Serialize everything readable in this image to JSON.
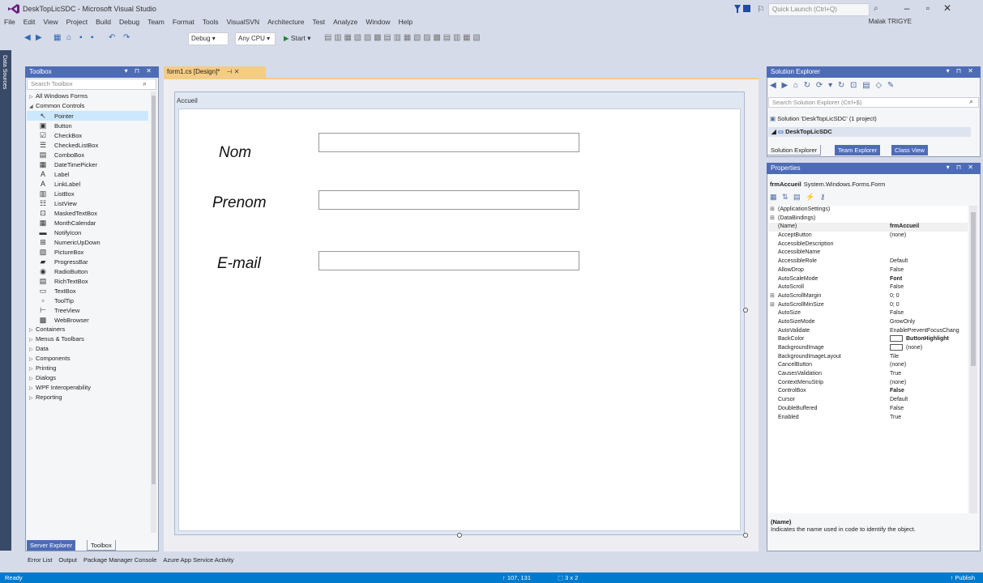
{
  "window": {
    "title": "DeskTopLicSDC - Microsoft Visual Studio",
    "quick_launch_placeholder": "Quick Launch (Ctrl+Q)",
    "user": "Malak TRIGYE"
  },
  "menu": [
    "File",
    "Edit",
    "View",
    "Project",
    "Build",
    "Debug",
    "Team",
    "Format",
    "Tools",
    "VisualSVN",
    "Architecture",
    "Test",
    "Analyze",
    "Window",
    "Help"
  ],
  "toolbar": {
    "config": "Debug",
    "platform": "Any CPU",
    "start": "Start"
  },
  "side_strip_label": "Data Sources",
  "toolbox": {
    "title": "Toolbox",
    "search_placeholder": "Search Toolbox",
    "items": [
      {
        "type": "cat",
        "arrow": "▷",
        "label": "All Windows Forms"
      },
      {
        "type": "cat",
        "arrow": "◢",
        "label": "Common Controls"
      },
      {
        "type": "item",
        "glyph": "↖",
        "label": "Pointer",
        "selected": true
      },
      {
        "type": "item",
        "glyph": "▣",
        "label": "Button"
      },
      {
        "type": "item",
        "glyph": "☑",
        "label": "CheckBox"
      },
      {
        "type": "item",
        "glyph": "☰",
        "label": "CheckedListBox"
      },
      {
        "type": "item",
        "glyph": "▤",
        "label": "ComboBox"
      },
      {
        "type": "item",
        "glyph": "▦",
        "label": "DateTimePicker"
      },
      {
        "type": "item",
        "glyph": "A",
        "label": "Label"
      },
      {
        "type": "item",
        "glyph": "A",
        "label": "LinkLabel"
      },
      {
        "type": "item",
        "glyph": "▥",
        "label": "ListBox"
      },
      {
        "type": "item",
        "glyph": "☷",
        "label": "ListView"
      },
      {
        "type": "item",
        "glyph": "⊡",
        "label": "MaskedTextBox"
      },
      {
        "type": "item",
        "glyph": "▦",
        "label": "MonthCalendar"
      },
      {
        "type": "item",
        "glyph": "▬",
        "label": "NotifyIcon"
      },
      {
        "type": "item",
        "glyph": "⊞",
        "label": "NumericUpDown"
      },
      {
        "type": "item",
        "glyph": "▨",
        "label": "PictureBox"
      },
      {
        "type": "item",
        "glyph": "▰",
        "label": "ProgressBar"
      },
      {
        "type": "item",
        "glyph": "◉",
        "label": "RadioButton"
      },
      {
        "type": "item",
        "glyph": "▤",
        "label": "RichTextBox"
      },
      {
        "type": "item",
        "glyph": "▭",
        "label": "TextBox"
      },
      {
        "type": "item",
        "glyph": "▫",
        "label": "ToolTip"
      },
      {
        "type": "item",
        "glyph": "⊢",
        "label": "TreeView"
      },
      {
        "type": "item",
        "glyph": "▩",
        "label": "WebBrowser"
      },
      {
        "type": "cat",
        "arrow": "▷",
        "label": "Containers"
      },
      {
        "type": "cat",
        "arrow": "▷",
        "label": "Menus & Toolbars"
      },
      {
        "type": "cat",
        "arrow": "▷",
        "label": "Data"
      },
      {
        "type": "cat",
        "arrow": "▷",
        "label": "Components"
      },
      {
        "type": "cat",
        "arrow": "▷",
        "label": "Printing"
      },
      {
        "type": "cat",
        "arrow": "▷",
        "label": "Dialogs"
      },
      {
        "type": "cat",
        "arrow": "▷",
        "label": "WPF Interoperability"
      },
      {
        "type": "cat",
        "arrow": "▷",
        "label": "Reporting"
      }
    ],
    "tab_server_explorer": "Server Explorer",
    "tab_toolbox": "Toolbox"
  },
  "document": {
    "tab_label": "form1.cs [Design]*",
    "form_title": "Accueil",
    "labels": {
      "nom": "Nom",
      "prenom": "Prenom",
      "email": "E-mail"
    }
  },
  "solution_explorer": {
    "title": "Solution Explorer",
    "search_placeholder": "Search Solution Explorer (Ctrl+$)",
    "solution_row": "Solution 'DeskTopLicSDC' (1 project)",
    "project_row": "DeskTopLicSDC",
    "tabs": [
      "Solution Explorer",
      "Team Explorer",
      "Class View"
    ]
  },
  "properties": {
    "title": "Properties",
    "object_name": "frmAccueil",
    "object_type": "System.Windows.Forms.Form",
    "rows": [
      {
        "exp": "⊞",
        "name": "(ApplicationSettings)",
        "value": ""
      },
      {
        "exp": "⊞",
        "name": "(DataBindings)",
        "value": ""
      },
      {
        "exp": "",
        "name": "(Name)",
        "value": "frmAccueil",
        "bold": true,
        "selected": true
      },
      {
        "exp": "",
        "name": "AcceptButton",
        "value": "(none)"
      },
      {
        "exp": "",
        "name": "AccessibleDescription",
        "value": ""
      },
      {
        "exp": "",
        "name": "AccessibleName",
        "value": ""
      },
      {
        "exp": "",
        "name": "AccessibleRole",
        "value": "Default"
      },
      {
        "exp": "",
        "name": "AllowDrop",
        "value": "False"
      },
      {
        "exp": "",
        "name": "AutoScaleMode",
        "value": "Font",
        "bold": true
      },
      {
        "exp": "",
        "name": "AutoScroll",
        "value": "False"
      },
      {
        "exp": "⊞",
        "name": "AutoScrollMargin",
        "value": "0; 0"
      },
      {
        "exp": "⊞",
        "name": "AutoScrollMinSize",
        "value": "0; 0"
      },
      {
        "exp": "",
        "name": "AutoSize",
        "value": "False"
      },
      {
        "exp": "",
        "name": "AutoSizeMode",
        "value": "GrowOnly"
      },
      {
        "exp": "",
        "name": "AutoValidate",
        "value": "EnablePreventFocusChang"
      },
      {
        "exp": "",
        "name": "BackColor",
        "value": "ButtonHighlight",
        "bold": true,
        "swatch": true
      },
      {
        "exp": "",
        "name": "BackgroundImage",
        "value": "(none)",
        "swatch": true
      },
      {
        "exp": "",
        "name": "BackgroundImageLayout",
        "value": "Tile"
      },
      {
        "exp": "",
        "name": "CancelButton",
        "value": "(none)"
      },
      {
        "exp": "",
        "name": "CausesValidation",
        "value": "True"
      },
      {
        "exp": "",
        "name": "ContextMenuStrip",
        "value": "(none)"
      },
      {
        "exp": "",
        "name": "ControlBox",
        "value": "False",
        "bold": true
      },
      {
        "exp": "",
        "name": "Cursor",
        "value": "Default"
      },
      {
        "exp": "",
        "name": "DoubleBuffered",
        "value": "False"
      },
      {
        "exp": "",
        "name": "Enabled",
        "value": "True"
      }
    ],
    "desc_title": "(Name)",
    "desc_text": "Indicates the name used in code to identify the object."
  },
  "bottom_tabs": [
    "Error List",
    "Output",
    "Package Manager Console",
    "Azure App Service Activity"
  ],
  "status": {
    "ready": "Ready",
    "position": "↑ 107, 131",
    "size": "⬚ 3 x 2",
    "publish": "↑ Publish"
  }
}
